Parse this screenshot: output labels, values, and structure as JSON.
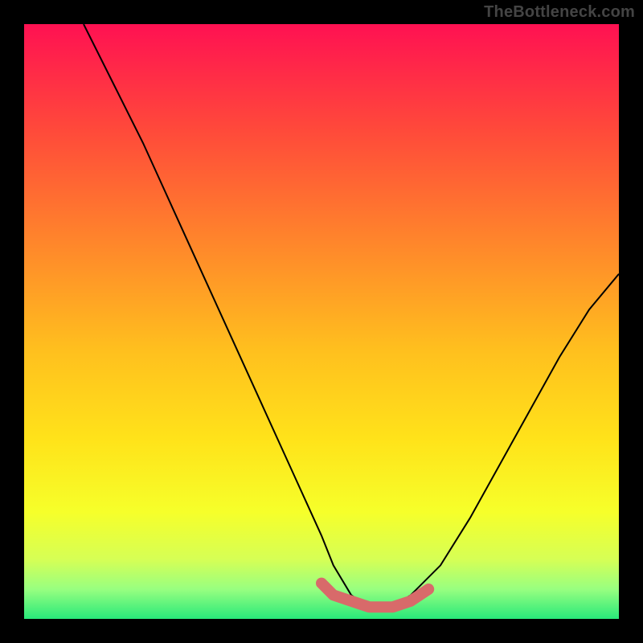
{
  "watermark": "TheBottleneck.com",
  "chart_data": {
    "type": "line",
    "title": "",
    "xlabel": "",
    "ylabel": "",
    "xlim": [
      0,
      100
    ],
    "ylim": [
      0,
      100
    ],
    "series": [
      {
        "name": "curve",
        "x": [
          10,
          15,
          20,
          25,
          30,
          35,
          40,
          45,
          50,
          52,
          55,
          58,
          60,
          62,
          65,
          70,
          75,
          80,
          85,
          90,
          95,
          100
        ],
        "y": [
          100,
          90,
          80,
          69,
          58,
          47,
          36,
          25,
          14,
          9,
          4,
          2,
          2,
          2,
          4,
          9,
          17,
          26,
          35,
          44,
          52,
          58
        ]
      }
    ],
    "highlight": {
      "name": "bottom-band",
      "x": [
        50,
        52,
        55,
        58,
        60,
        62,
        65,
        68
      ],
      "y": [
        6,
        4,
        3,
        2,
        2,
        2,
        3,
        5
      ],
      "color": "#d86a6a",
      "stroke_width": 14
    },
    "background": {
      "type": "vertical-gradient",
      "stops": [
        {
          "offset": 0.0,
          "color": "#ff1152"
        },
        {
          "offset": 0.18,
          "color": "#ff4a3a"
        },
        {
          "offset": 0.38,
          "color": "#ff8a2a"
        },
        {
          "offset": 0.55,
          "color": "#ffc01e"
        },
        {
          "offset": 0.7,
          "color": "#ffe31a"
        },
        {
          "offset": 0.82,
          "color": "#f6ff2a"
        },
        {
          "offset": 0.9,
          "color": "#d6ff55"
        },
        {
          "offset": 0.95,
          "color": "#98ff80"
        },
        {
          "offset": 1.0,
          "color": "#28e97a"
        }
      ]
    }
  }
}
